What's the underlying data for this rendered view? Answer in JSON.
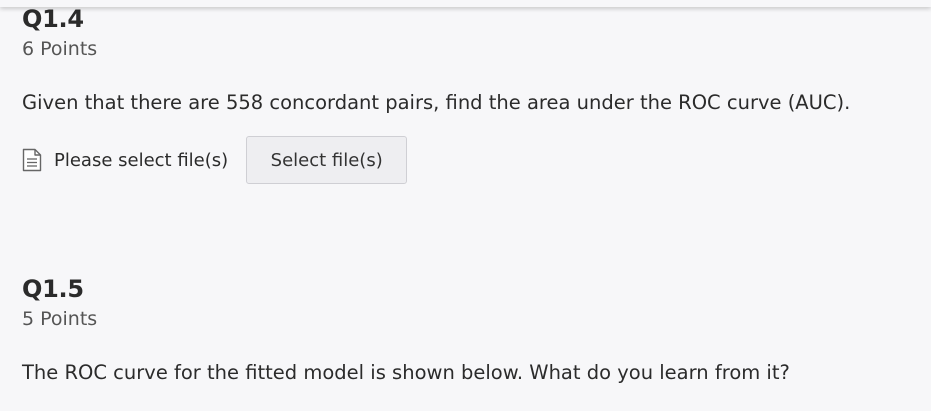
{
  "questions": [
    {
      "title": "Q1.4",
      "points": "6 Points",
      "text": "Given that there are 558 concordant pairs, find the area under the ROC curve (AUC).",
      "upload": {
        "icon": "file-text-icon",
        "label": "Please select file(s)",
        "button_label": "Select file(s)"
      }
    },
    {
      "title": "Q1.5",
      "points": "5 Points",
      "text": "The ROC curve for the fitted model is shown below. What do you learn from it?"
    }
  ]
}
